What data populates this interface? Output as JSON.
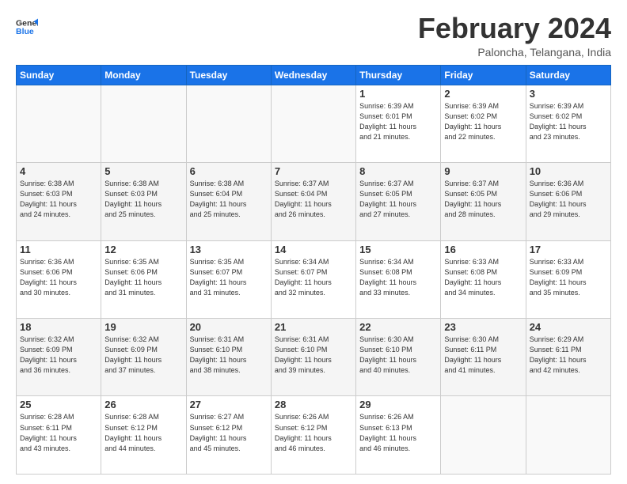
{
  "logo": {
    "line1": "General",
    "line2": "Blue"
  },
  "title": "February 2024",
  "location": "Paloncha, Telangana, India",
  "days_header": [
    "Sunday",
    "Monday",
    "Tuesday",
    "Wednesday",
    "Thursday",
    "Friday",
    "Saturday"
  ],
  "weeks": [
    [
      {
        "num": "",
        "info": ""
      },
      {
        "num": "",
        "info": ""
      },
      {
        "num": "",
        "info": ""
      },
      {
        "num": "",
        "info": ""
      },
      {
        "num": "1",
        "info": "Sunrise: 6:39 AM\nSunset: 6:01 PM\nDaylight: 11 hours\nand 21 minutes."
      },
      {
        "num": "2",
        "info": "Sunrise: 6:39 AM\nSunset: 6:02 PM\nDaylight: 11 hours\nand 22 minutes."
      },
      {
        "num": "3",
        "info": "Sunrise: 6:39 AM\nSunset: 6:02 PM\nDaylight: 11 hours\nand 23 minutes."
      }
    ],
    [
      {
        "num": "4",
        "info": "Sunrise: 6:38 AM\nSunset: 6:03 PM\nDaylight: 11 hours\nand 24 minutes."
      },
      {
        "num": "5",
        "info": "Sunrise: 6:38 AM\nSunset: 6:03 PM\nDaylight: 11 hours\nand 25 minutes."
      },
      {
        "num": "6",
        "info": "Sunrise: 6:38 AM\nSunset: 6:04 PM\nDaylight: 11 hours\nand 25 minutes."
      },
      {
        "num": "7",
        "info": "Sunrise: 6:37 AM\nSunset: 6:04 PM\nDaylight: 11 hours\nand 26 minutes."
      },
      {
        "num": "8",
        "info": "Sunrise: 6:37 AM\nSunset: 6:05 PM\nDaylight: 11 hours\nand 27 minutes."
      },
      {
        "num": "9",
        "info": "Sunrise: 6:37 AM\nSunset: 6:05 PM\nDaylight: 11 hours\nand 28 minutes."
      },
      {
        "num": "10",
        "info": "Sunrise: 6:36 AM\nSunset: 6:06 PM\nDaylight: 11 hours\nand 29 minutes."
      }
    ],
    [
      {
        "num": "11",
        "info": "Sunrise: 6:36 AM\nSunset: 6:06 PM\nDaylight: 11 hours\nand 30 minutes."
      },
      {
        "num": "12",
        "info": "Sunrise: 6:35 AM\nSunset: 6:06 PM\nDaylight: 11 hours\nand 31 minutes."
      },
      {
        "num": "13",
        "info": "Sunrise: 6:35 AM\nSunset: 6:07 PM\nDaylight: 11 hours\nand 31 minutes."
      },
      {
        "num": "14",
        "info": "Sunrise: 6:34 AM\nSunset: 6:07 PM\nDaylight: 11 hours\nand 32 minutes."
      },
      {
        "num": "15",
        "info": "Sunrise: 6:34 AM\nSunset: 6:08 PM\nDaylight: 11 hours\nand 33 minutes."
      },
      {
        "num": "16",
        "info": "Sunrise: 6:33 AM\nSunset: 6:08 PM\nDaylight: 11 hours\nand 34 minutes."
      },
      {
        "num": "17",
        "info": "Sunrise: 6:33 AM\nSunset: 6:09 PM\nDaylight: 11 hours\nand 35 minutes."
      }
    ],
    [
      {
        "num": "18",
        "info": "Sunrise: 6:32 AM\nSunset: 6:09 PM\nDaylight: 11 hours\nand 36 minutes."
      },
      {
        "num": "19",
        "info": "Sunrise: 6:32 AM\nSunset: 6:09 PM\nDaylight: 11 hours\nand 37 minutes."
      },
      {
        "num": "20",
        "info": "Sunrise: 6:31 AM\nSunset: 6:10 PM\nDaylight: 11 hours\nand 38 minutes."
      },
      {
        "num": "21",
        "info": "Sunrise: 6:31 AM\nSunset: 6:10 PM\nDaylight: 11 hours\nand 39 minutes."
      },
      {
        "num": "22",
        "info": "Sunrise: 6:30 AM\nSunset: 6:10 PM\nDaylight: 11 hours\nand 40 minutes."
      },
      {
        "num": "23",
        "info": "Sunrise: 6:30 AM\nSunset: 6:11 PM\nDaylight: 11 hours\nand 41 minutes."
      },
      {
        "num": "24",
        "info": "Sunrise: 6:29 AM\nSunset: 6:11 PM\nDaylight: 11 hours\nand 42 minutes."
      }
    ],
    [
      {
        "num": "25",
        "info": "Sunrise: 6:28 AM\nSunset: 6:11 PM\nDaylight: 11 hours\nand 43 minutes."
      },
      {
        "num": "26",
        "info": "Sunrise: 6:28 AM\nSunset: 6:12 PM\nDaylight: 11 hours\nand 44 minutes."
      },
      {
        "num": "27",
        "info": "Sunrise: 6:27 AM\nSunset: 6:12 PM\nDaylight: 11 hours\nand 45 minutes."
      },
      {
        "num": "28",
        "info": "Sunrise: 6:26 AM\nSunset: 6:12 PM\nDaylight: 11 hours\nand 46 minutes."
      },
      {
        "num": "29",
        "info": "Sunrise: 6:26 AM\nSunset: 6:13 PM\nDaylight: 11 hours\nand 46 minutes."
      },
      {
        "num": "",
        "info": ""
      },
      {
        "num": "",
        "info": ""
      }
    ]
  ]
}
